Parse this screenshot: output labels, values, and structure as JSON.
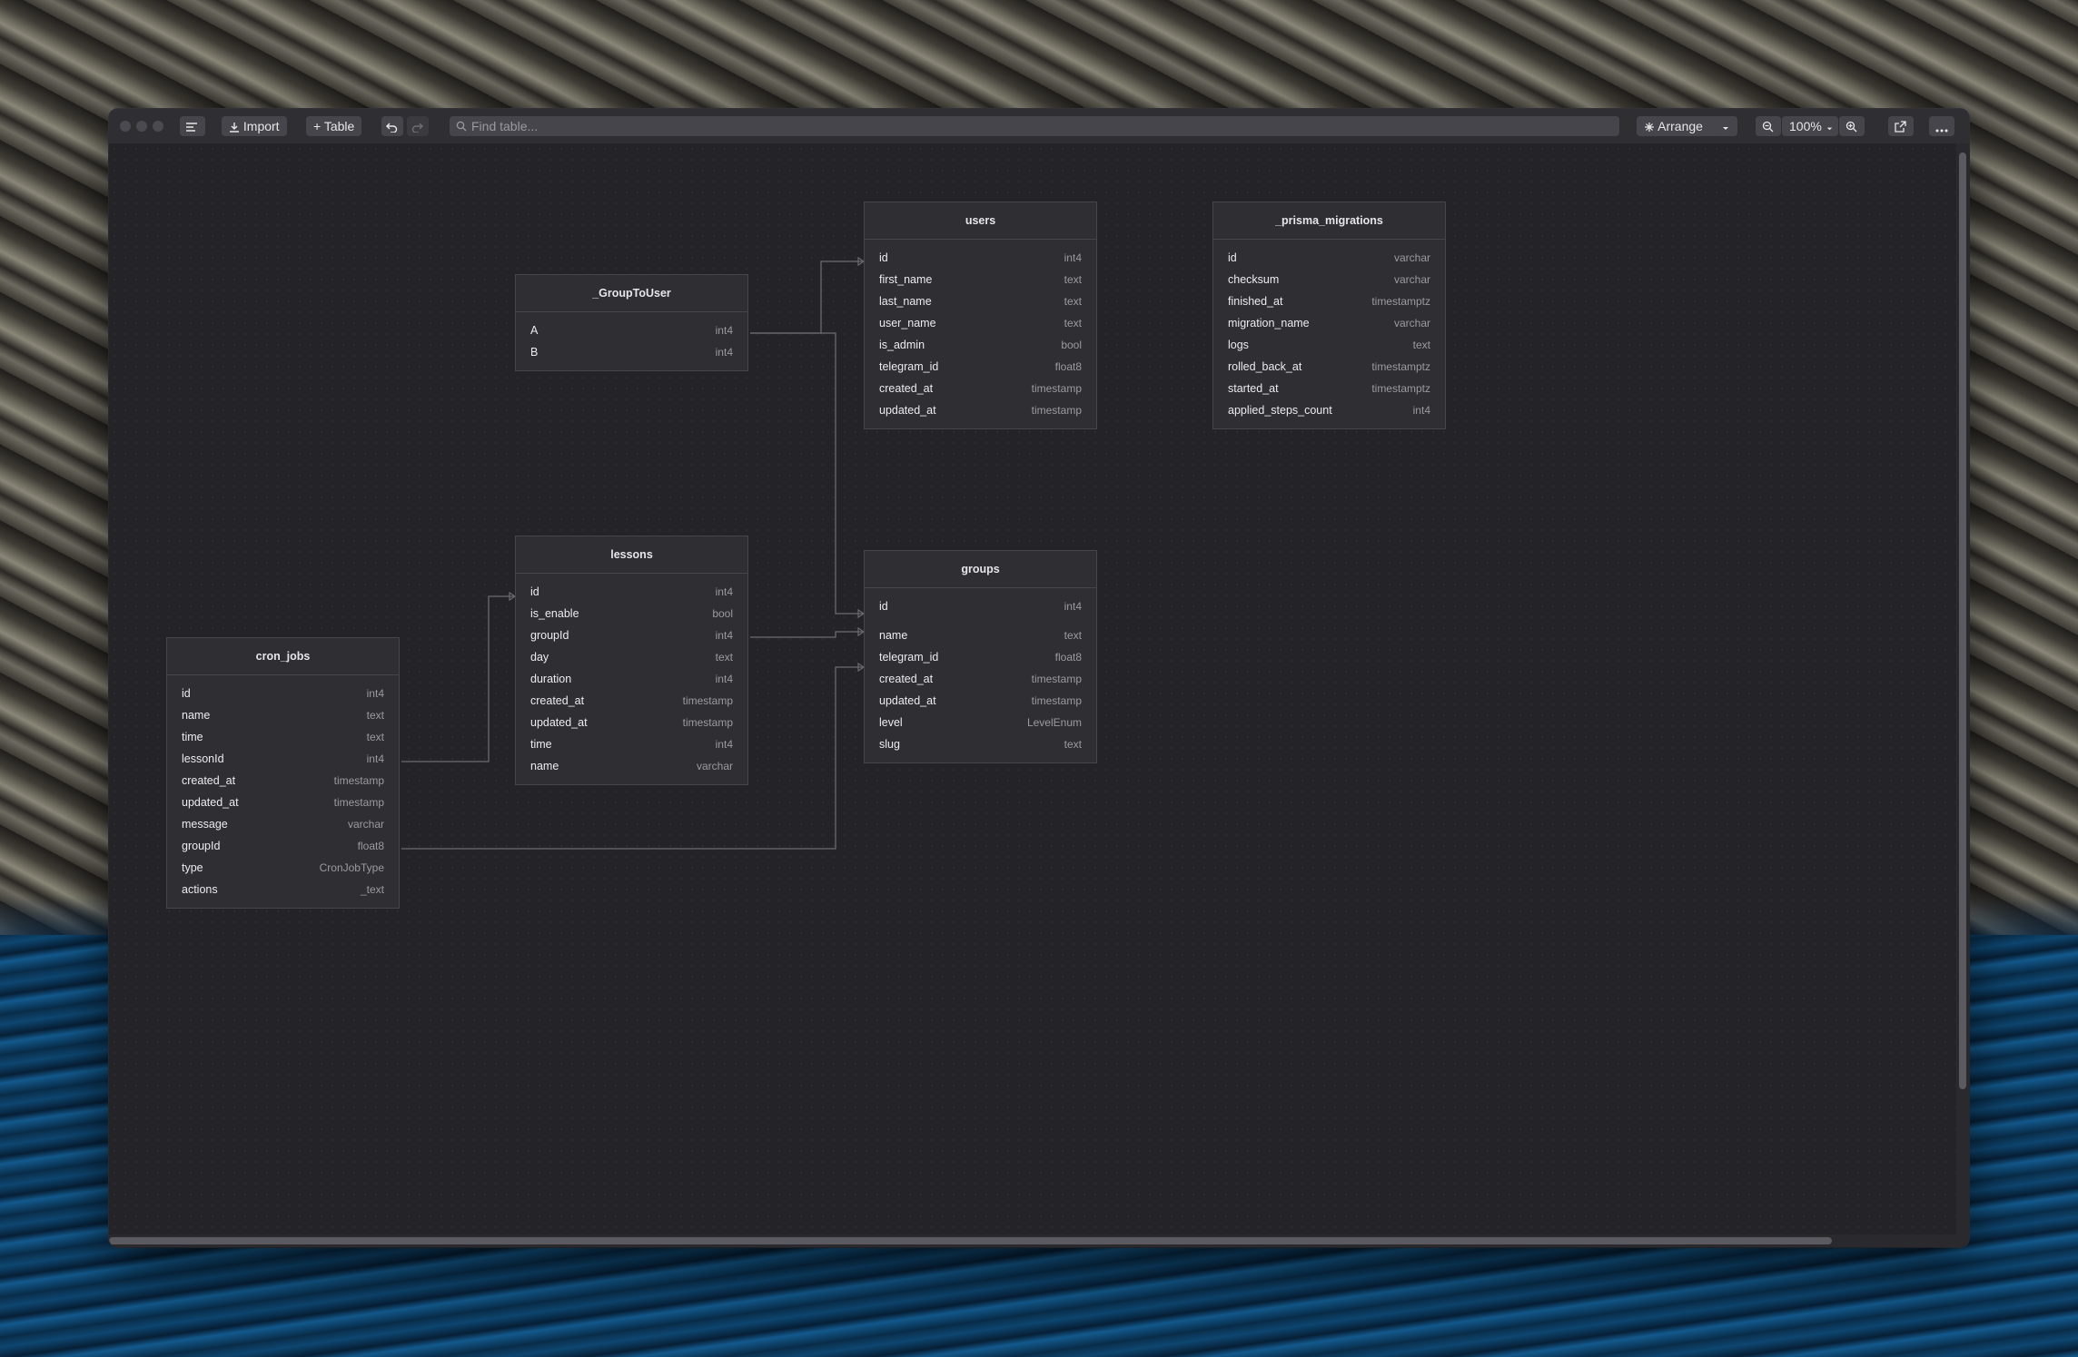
{
  "toolbar": {
    "import_label": "Import",
    "table_label": "+ Table",
    "search_placeholder": "Find table...",
    "arrange_label": "Arrange",
    "zoom_label": "100%"
  },
  "tables": {
    "users": {
      "name": "users",
      "columns": [
        {
          "name": "id",
          "type": "int4"
        },
        {
          "name": "first_name",
          "type": "text"
        },
        {
          "name": "last_name",
          "type": "text"
        },
        {
          "name": "user_name",
          "type": "text"
        },
        {
          "name": "is_admin",
          "type": "bool"
        },
        {
          "name": "telegram_id",
          "type": "float8"
        },
        {
          "name": "created_at",
          "type": "timestamp"
        },
        {
          "name": "updated_at",
          "type": "timestamp"
        }
      ]
    },
    "prisma_migrations": {
      "name": "_prisma_migrations",
      "columns": [
        {
          "name": "id",
          "type": "varchar"
        },
        {
          "name": "checksum",
          "type": "varchar"
        },
        {
          "name": "finished_at",
          "type": "timestamptz"
        },
        {
          "name": "migration_name",
          "type": "varchar"
        },
        {
          "name": "logs",
          "type": "text"
        },
        {
          "name": "rolled_back_at",
          "type": "timestamptz"
        },
        {
          "name": "started_at",
          "type": "timestamptz"
        },
        {
          "name": "applied_steps_count",
          "type": "int4"
        }
      ]
    },
    "group_to_user": {
      "name": "_GroupToUser",
      "columns": [
        {
          "name": "A",
          "type": "int4"
        },
        {
          "name": "B",
          "type": "int4"
        }
      ]
    },
    "lessons": {
      "name": "lessons",
      "columns": [
        {
          "name": "id",
          "type": "int4"
        },
        {
          "name": "is_enable",
          "type": "bool"
        },
        {
          "name": "groupId",
          "type": "int4"
        },
        {
          "name": "day",
          "type": "text"
        },
        {
          "name": "duration",
          "type": "int4"
        },
        {
          "name": "created_at",
          "type": "timestamp"
        },
        {
          "name": "updated_at",
          "type": "timestamp"
        },
        {
          "name": "time",
          "type": "int4"
        },
        {
          "name": "name",
          "type": "varchar"
        }
      ]
    },
    "groups": {
      "name": "groups",
      "columns": [
        {
          "name": "id",
          "type": "int4"
        },
        {
          "name": "name",
          "type": "text"
        },
        {
          "name": "telegram_id",
          "type": "float8"
        },
        {
          "name": "created_at",
          "type": "timestamp"
        },
        {
          "name": "updated_at",
          "type": "timestamp"
        },
        {
          "name": "level",
          "type": "LevelEnum"
        },
        {
          "name": "slug",
          "type": "text"
        }
      ]
    },
    "cron_jobs": {
      "name": "cron_jobs",
      "columns": [
        {
          "name": "id",
          "type": "int4"
        },
        {
          "name": "name",
          "type": "text"
        },
        {
          "name": "time",
          "type": "text"
        },
        {
          "name": "lessonId",
          "type": "int4"
        },
        {
          "name": "created_at",
          "type": "timestamp"
        },
        {
          "name": "updated_at",
          "type": "timestamp"
        },
        {
          "name": "message",
          "type": "varchar"
        },
        {
          "name": "groupId",
          "type": "float8"
        },
        {
          "name": "type",
          "type": "CronJobType"
        },
        {
          "name": "actions",
          "type": "_text"
        }
      ]
    }
  }
}
